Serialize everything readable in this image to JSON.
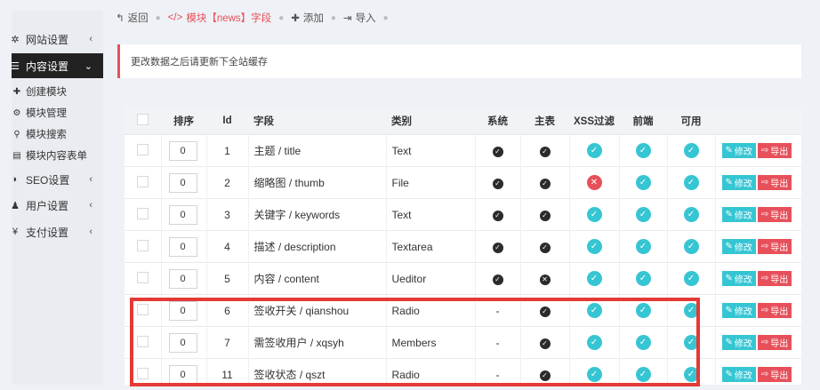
{
  "sidebar": {
    "items": [
      {
        "label": "网站设置",
        "icon": "gear-icon",
        "has_arrow": true
      },
      {
        "label": "内容设置",
        "icon": "list-icon",
        "has_arrow": true,
        "active": true
      },
      {
        "label": "SEO设置",
        "icon": "seo-icon",
        "has_arrow": true
      },
      {
        "label": "用户设置",
        "icon": "user-icon",
        "has_arrow": true
      },
      {
        "label": "支付设置",
        "icon": "yen-icon",
        "has_arrow": true
      }
    ],
    "subitems": [
      {
        "label": "创建模块",
        "icon": "plus-icon"
      },
      {
        "label": "模块管理",
        "icon": "cogs-icon"
      },
      {
        "label": "模块搜索",
        "icon": "search-icon"
      },
      {
        "label": "模块内容表单",
        "icon": "table-icon"
      }
    ]
  },
  "breadcrumb": {
    "back": "返回",
    "current": "模块【news】字段",
    "add": "添加",
    "import": "导入"
  },
  "notice": "更改数据之后请更新下全站缓存",
  "table": {
    "headers": [
      "",
      "排序",
      "Id",
      "字段",
      "类别",
      "系统",
      "主表",
      "XSS过滤",
      "前端",
      "可用",
      ""
    ],
    "rows": [
      {
        "order": "0",
        "id": "1",
        "field": "主题 / title",
        "type": "Text",
        "system": "check",
        "main": "check",
        "xss": "check",
        "front": "check",
        "enabled": "check"
      },
      {
        "order": "0",
        "id": "2",
        "field": "缩略图 / thumb",
        "type": "File",
        "system": "check",
        "main": "check",
        "xss": "cross",
        "front": "check",
        "enabled": "check"
      },
      {
        "order": "0",
        "id": "3",
        "field": "关键字 / keywords",
        "type": "Text",
        "system": "check",
        "main": "check",
        "xss": "check",
        "front": "check",
        "enabled": "check"
      },
      {
        "order": "0",
        "id": "4",
        "field": "描述 / description",
        "type": "Textarea",
        "system": "check",
        "main": "check",
        "xss": "check",
        "front": "check",
        "enabled": "check"
      },
      {
        "order": "0",
        "id": "5",
        "field": "内容 / content",
        "type": "Ueditor",
        "system": "check",
        "main": "cross",
        "xss": "check",
        "front": "check",
        "enabled": "check"
      },
      {
        "order": "0",
        "id": "6",
        "field": "签收开关 / qianshou",
        "type": "Radio",
        "system": "-",
        "main": "check",
        "xss": "check",
        "front": "check",
        "enabled": "check"
      },
      {
        "order": "0",
        "id": "7",
        "field": "需签收用户 / xqsyh",
        "type": "Members",
        "system": "-",
        "main": "check",
        "xss": "check",
        "front": "check",
        "enabled": "check"
      },
      {
        "order": "0",
        "id": "11",
        "field": "签收状态 / qszt",
        "type": "Radio",
        "system": "-",
        "main": "check",
        "xss": "check",
        "front": "check",
        "enabled": "check"
      }
    ],
    "edit_label": "修改",
    "export_label": "导出"
  }
}
